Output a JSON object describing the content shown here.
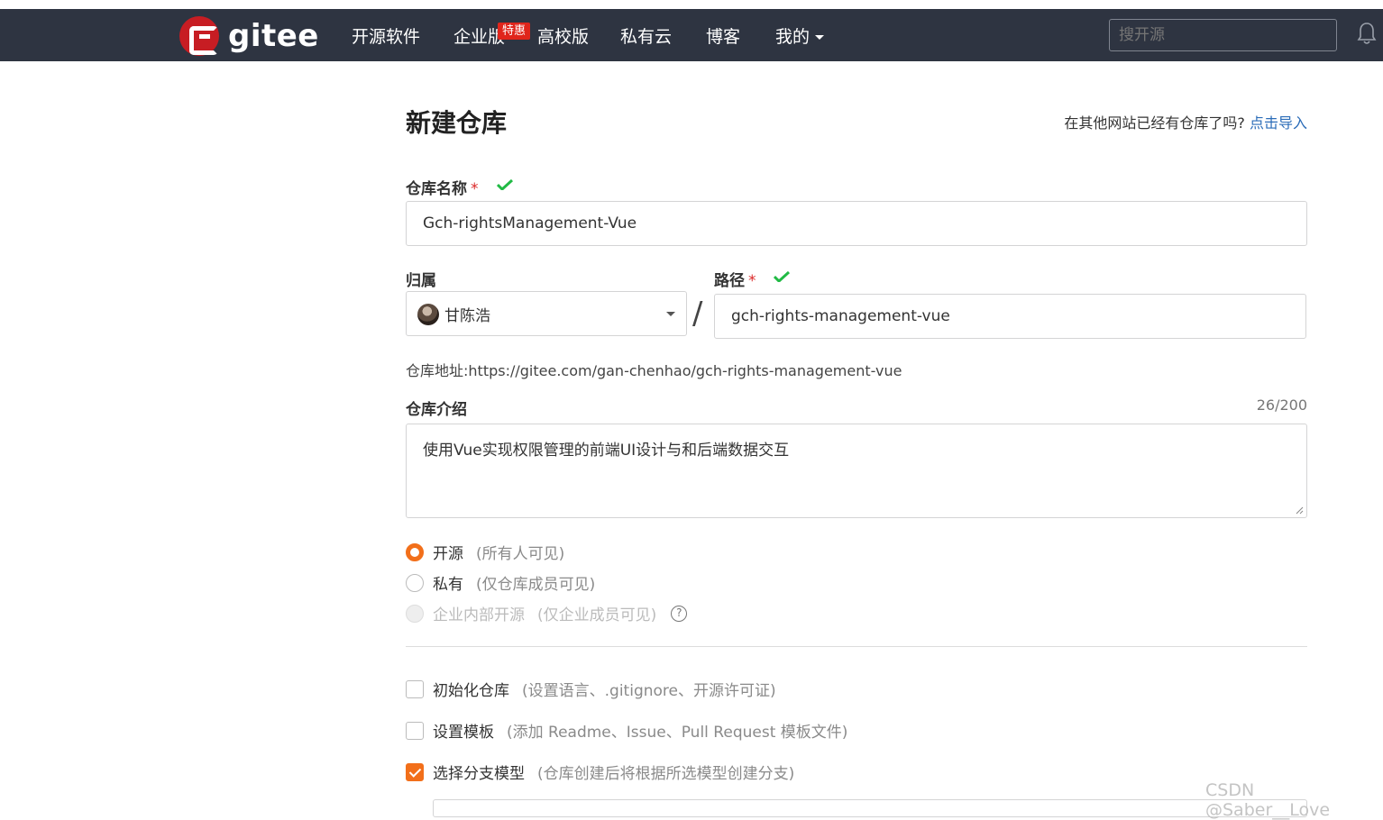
{
  "navbar": {
    "logo_text": "gitee",
    "items": [
      {
        "label": "开源软件"
      },
      {
        "label": "企业版"
      },
      {
        "label": "高校版"
      },
      {
        "label": "私有云"
      },
      {
        "label": "博客"
      },
      {
        "label": "我的"
      }
    ],
    "hot_badge": "特惠",
    "search_placeholder": "搜开源"
  },
  "page": {
    "title": "新建仓库",
    "import_prompt": "在其他网站已经有仓库了吗?",
    "import_link": "点击导入"
  },
  "form": {
    "repo_name_label": "仓库名称",
    "required_mark": "*",
    "repo_name_value": "Gch-rightsManagement-Vue",
    "owner_label": "归属",
    "owner_name": "甘陈浩",
    "path_label": "路径",
    "path_value": "gch-rights-management-vue",
    "slash": "/",
    "repo_url_label": "仓库地址:",
    "repo_url": "https://gitee.com/gan-chenhao/gch-rights-management-vue",
    "intro_label": "仓库介绍",
    "intro_counter": "26/200",
    "intro_value": "使用Vue实现权限管理的前端UI设计与和后端数据交互",
    "visibility": [
      {
        "label": "开源",
        "hint": "(所有人可见)",
        "selected": true,
        "disabled": false
      },
      {
        "label": "私有",
        "hint": "(仅仓库成员可见)",
        "selected": false,
        "disabled": false
      },
      {
        "label": "企业内部开源",
        "hint": "(仅企业成员可见)",
        "selected": false,
        "disabled": true
      }
    ],
    "help_glyph": "?",
    "options": [
      {
        "label": "初始化仓库",
        "hint": "(设置语言、.gitignore、开源许可证)",
        "checked": false
      },
      {
        "label": "设置模板",
        "hint": "(添加 Readme、Issue、Pull Request 模板文件)",
        "checked": false
      },
      {
        "label": "选择分支模型",
        "hint": "(仓库创建后将根据所选模型创建分支)",
        "checked": true
      }
    ]
  },
  "watermark": "CSDN @Saber__Love",
  "colors": {
    "navbar": "#2e3441",
    "accent": "#f26f1a",
    "brand": "#c71d23",
    "check": "#21ba45"
  }
}
